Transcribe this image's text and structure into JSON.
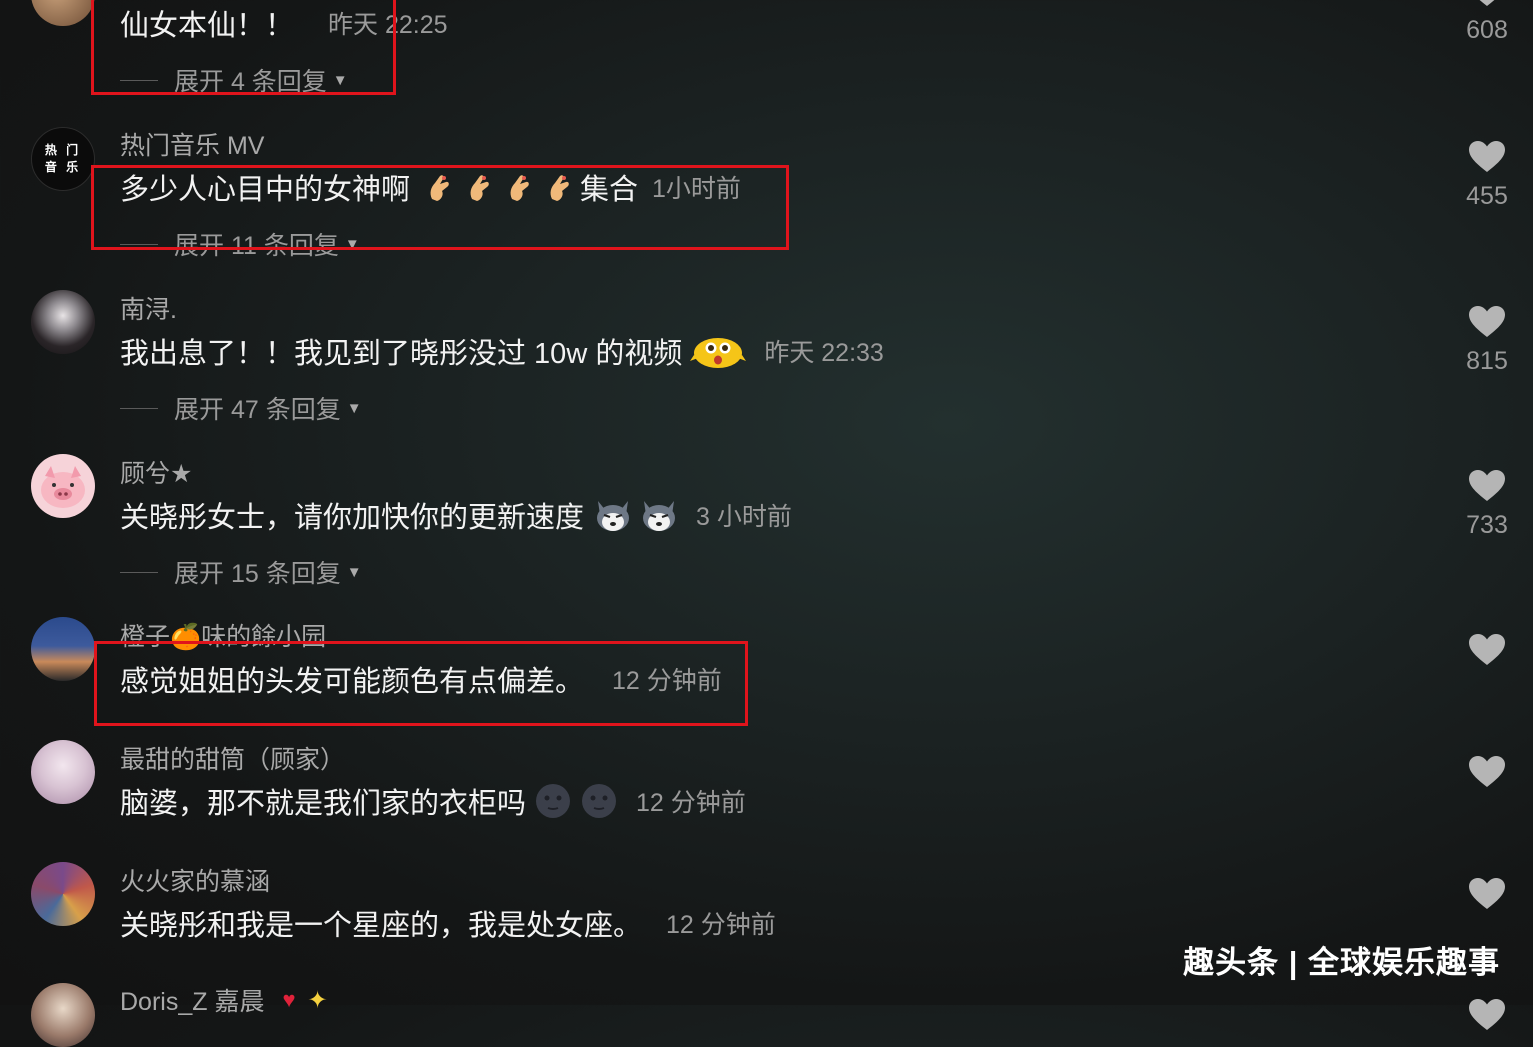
{
  "comments": [
    {
      "text": "仙女本仙！！",
      "time": "昨天 22:25",
      "expand": "展开 4 条回复",
      "likes": "608"
    },
    {
      "user": "热门音乐 MV",
      "avatar_text": "热 门\n音 乐",
      "text": "多少人心目中的女神啊",
      "text_after": "集合",
      "time": "1小时前",
      "expand": "展开 11 条回复",
      "likes": "455"
    },
    {
      "user": "南浔.",
      "text": "我出息了！！我见到了晓彤没过 10w 的视频",
      "time": "昨天 22:33",
      "expand": "展开 47 条回复",
      "likes": "815"
    },
    {
      "user": "顾兮★",
      "text": "关晓彤女士，请你加快你的更新速度",
      "time": "3 小时前",
      "expand": "展开 15 条回复",
      "likes": "733"
    },
    {
      "user": "橙子🍊味的餘小园",
      "text": "感觉姐姐的头发可能颜色有点偏差。",
      "time": "12 分钟前"
    },
    {
      "user": "最甜的甜筒（顾家）",
      "text": "脑婆，那不就是我们家的衣柜吗",
      "time": "12 分钟前"
    },
    {
      "user": "火火家的慕涵",
      "text": "关晓彤和我是一个星座的，我是处女座。",
      "time": "12 分钟前"
    },
    {
      "user": "Doris_Z 嘉晨"
    }
  ],
  "watermark": "趣头条 | 全球娱乐趣事",
  "colors": {
    "highlight_box": "#e0141c",
    "background": "#151818"
  },
  "icons": [
    "heart-icon",
    "caret-down-icon"
  ]
}
